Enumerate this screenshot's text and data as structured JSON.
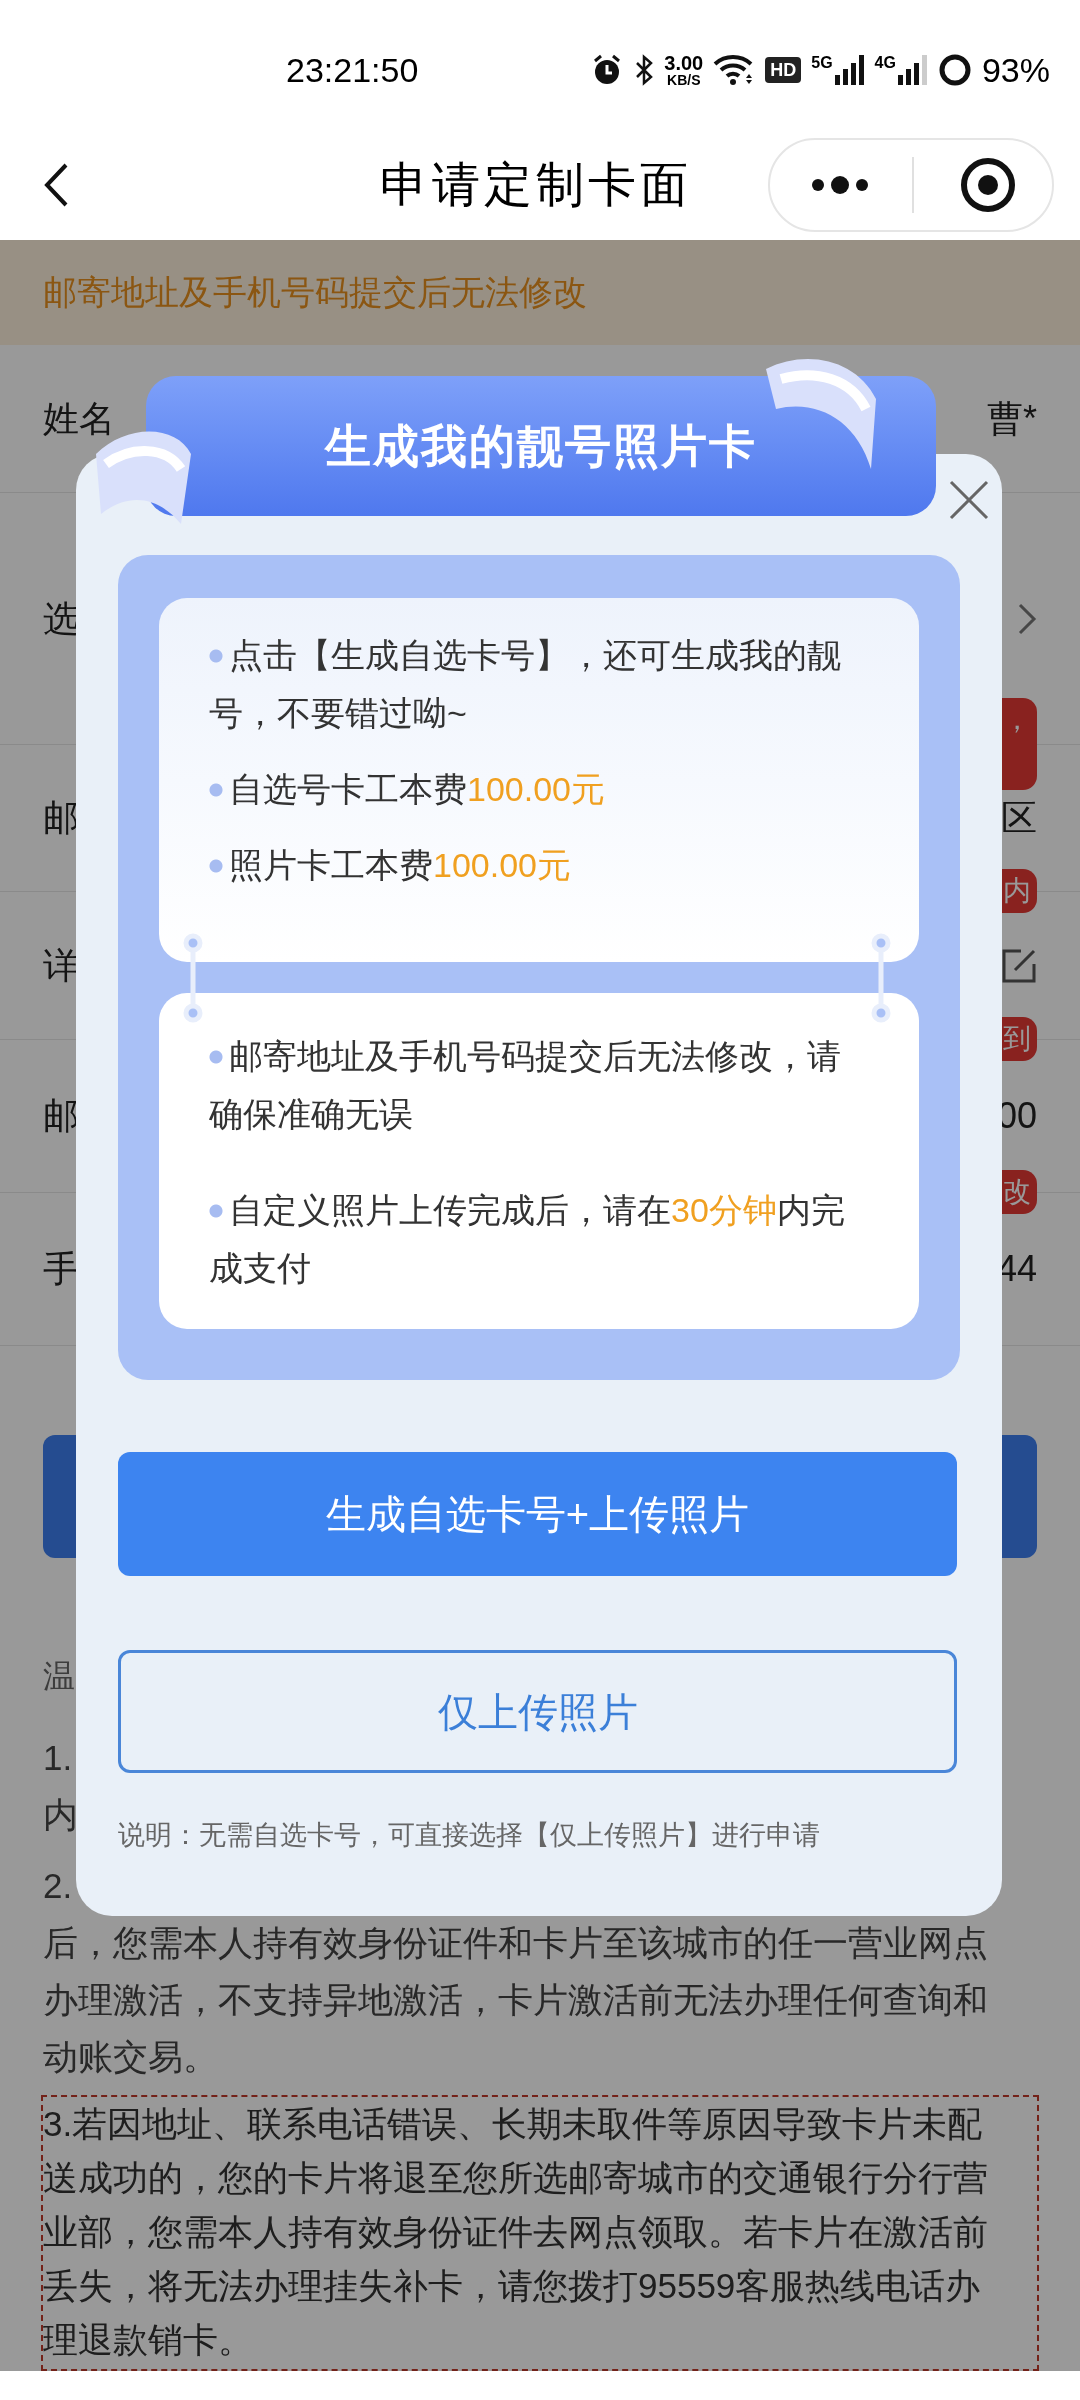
{
  "status_bar": {
    "time": "23:21:50",
    "speed_value": "3.00",
    "speed_unit": "KB/S",
    "hd_label": "HD",
    "networks": [
      "5G",
      "4G"
    ],
    "battery": "93%"
  },
  "header": {
    "title": "申请定制卡面"
  },
  "notice": {
    "text": "邮寄地址及手机号码提交后无法修改"
  },
  "form_rows": [
    {
      "kind": "text",
      "label": "姓名",
      "value": "曹*"
    },
    {
      "kind": "select",
      "label": "选",
      "tip": "，"
    },
    {
      "kind": "text",
      "label": "邮",
      "value": "区",
      "tip": "内"
    },
    {
      "kind": "edit",
      "label": "详",
      "tip": "到"
    },
    {
      "kind": "text",
      "label": "邮",
      "value": "00",
      "tip": "改"
    },
    {
      "kind": "text",
      "label": "手",
      "value": "44"
    }
  ],
  "tips": {
    "title": "温",
    "paragraphs": [
      {
        "highlighted": false,
        "lines": [
          "1.",
          "内"
        ]
      },
      {
        "highlighted": false,
        "lines": [
          "2.",
          "后，您需本人持有效身份证件和卡片至该城市的任一营业网点",
          "办理激活，不支持异地激活，卡片激活前无法办理任何查询和",
          "动账交易。"
        ]
      },
      {
        "highlighted": true,
        "lines": [
          "3.若因地址、联系电话错误、长期未取件等原因导致卡片未配",
          "送成功的，您的卡片将退至您所选邮寄城市的交通银行分行营",
          "业部，您需本人持有效身份证件去网点领取。若卡片在激活前",
          "丢失，将无法办理挂失补卡，请您拨打95559客服热线电话办",
          "理退款销卡。"
        ]
      }
    ]
  },
  "modal": {
    "title": "生成我的靓号照片卡",
    "cards": [
      {
        "items": [
          [
            {
              "text": "点击【生成自选卡号】，还可生成我的靓号，不要错过呦~",
              "accent": false
            }
          ],
          [
            {
              "text": "自选号卡工本费",
              "accent": false
            },
            {
              "text": "100.00元",
              "accent": true
            }
          ],
          [
            {
              "text": "照片卡工本费",
              "accent": false
            },
            {
              "text": "100.00元",
              "accent": true
            }
          ]
        ]
      },
      {
        "items": [
          [
            {
              "text": "邮寄地址及手机号码提交后无法修改，请确保准确无误",
              "accent": false
            }
          ],
          [
            {
              "text": "自定义照片上传完成后，请在",
              "accent": false
            },
            {
              "text": "30分钟",
              "accent": true
            },
            {
              "text": "内完成支付",
              "accent": false
            }
          ]
        ]
      }
    ],
    "primary_button": "生成自选卡号+上传照片",
    "secondary_button": "仅上传照片",
    "note": "说明：无需自选卡号，可直接选择【仅上传照片】进行申请"
  }
}
